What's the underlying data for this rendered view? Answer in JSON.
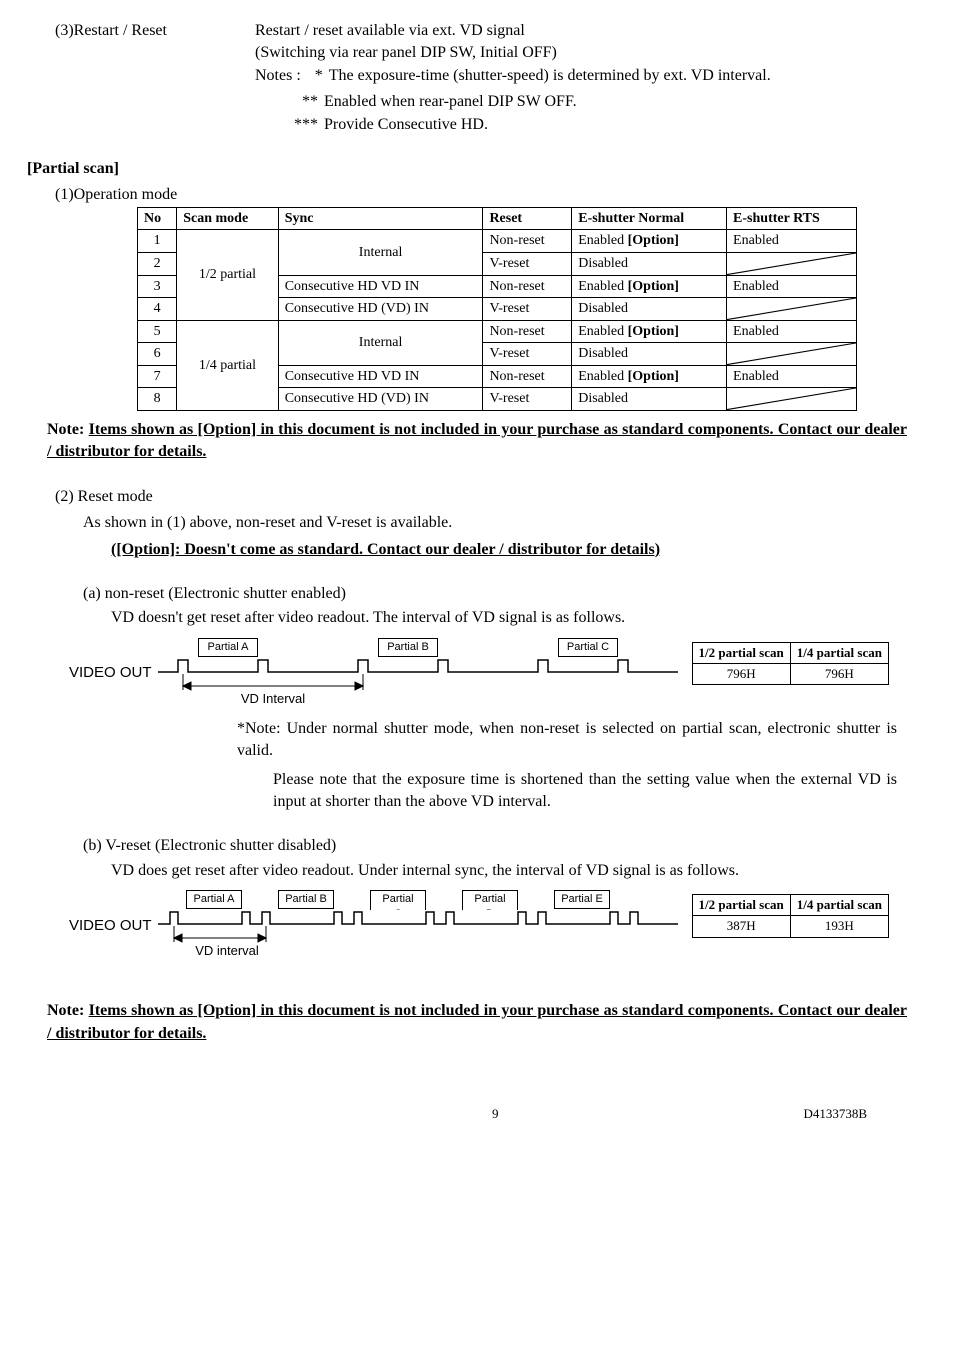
{
  "restart": {
    "label": "(3)Restart / Reset",
    "line1": "Restart / reset available via ext. VD signal",
    "line2": "(Switching via rear panel DIP SW, Initial OFF)",
    "notes_label": "Notes : ",
    "n1_stars": "*",
    "n1": "The exposure-time (shutter-speed) is determined by ext. VD interval.",
    "n2_stars": "**",
    "n2": "Enabled when rear-panel DIP SW OFF.",
    "n3_stars": "***",
    "n3": "Provide Consecutive HD."
  },
  "partial": {
    "heading": "[Partial scan]",
    "op_label": "(1)Operation mode",
    "table": {
      "headers": {
        "no": "No",
        "mode": "Scan mode",
        "sync": "Sync",
        "reset": "Reset",
        "normal": "E-shutter Normal",
        "rts": "E-shutter RTS"
      },
      "groups": [
        {
          "mode": "1/2 partial",
          "rows": [
            {
              "no": "1",
              "sync": "Internal",
              "sync_span": 2,
              "reset": "Non-reset",
              "normal": "Enabled [Option]",
              "rts": "Enabled"
            },
            {
              "no": "2",
              "reset": "V-reset",
              "normal": "Disabled",
              "rts_diag": true
            },
            {
              "no": "3",
              "sync": "Consecutive HD VD IN",
              "reset": "Non-reset",
              "normal": "Enabled [Option]",
              "rts": "Enabled"
            },
            {
              "no": "4",
              "sync": "Consecutive HD (VD) IN",
              "reset": "V-reset",
              "normal": "Disabled",
              "rts_diag": true
            }
          ]
        },
        {
          "mode": "1/4 partial",
          "rows": [
            {
              "no": "5",
              "sync": "Internal",
              "sync_span": 2,
              "reset": "Non-reset",
              "normal": "Enabled [Option]",
              "rts": "Enabled"
            },
            {
              "no": "6",
              "reset": "V-reset",
              "normal": "Disabled",
              "rts_diag": true
            },
            {
              "no": "7",
              "sync": "Consecutive HD VD IN",
              "reset": "Non-reset",
              "normal": "Enabled [Option]",
              "rts": "Enabled"
            },
            {
              "no": "8",
              "sync": "Consecutive HD (VD) IN",
              "reset": "V-reset",
              "normal": "Disabled",
              "rts_diag": true
            }
          ]
        }
      ]
    },
    "note1a": "Note: ",
    "note1b": "Items shown as [Option] in this document is not included in your purchase as standard components. Contact our dealer / distributor for details.",
    "reset_label": "(2) Reset mode",
    "reset_line": "As shown in (1) above, non-reset and V-reset is available.",
    "option_line": "([Option]: Doesn't come as standard. Contact our dealer / distributor for details)",
    "a_label": "(a) non-reset (Electronic shutter enabled)",
    "a_line": "VD doesn't get reset after video readout. The interval of VD signal is as follows.",
    "videoout": "VIDEO OUT",
    "vd_interval_a": "VD Interval",
    "vd_interval_b": "VD interval",
    "partials": {
      "A": "Partial A",
      "B": "Partial B",
      "C": "Partial C",
      "D": "Partial D",
      "E": "Partial E"
    },
    "scantable": {
      "h1": "1/2 partial scan",
      "h2": "1/4 partial scan",
      "a1": "796H",
      "a2": "796H",
      "b1": "387H",
      "b2": "193H"
    },
    "a_note1": "*Note: Under normal shutter mode, when non-reset is selected on partial scan, electronic shutter is valid.",
    "a_note2": "Please note that the exposure time is shortened than the setting value when the external VD is input at shorter than the above VD interval.",
    "b_label": "(b) V-reset (Electronic shutter disabled)",
    "b_line": "VD does get reset after video readout. Under internal sync, the interval of VD signal is as follows.",
    "final_note_a": "Note: ",
    "final_note_b": "Items shown as [Option] in this document is not included in your purchase as standard components. Contact our dealer / distributor for details."
  },
  "footer": {
    "page": "9",
    "doc": "D4133738B"
  }
}
